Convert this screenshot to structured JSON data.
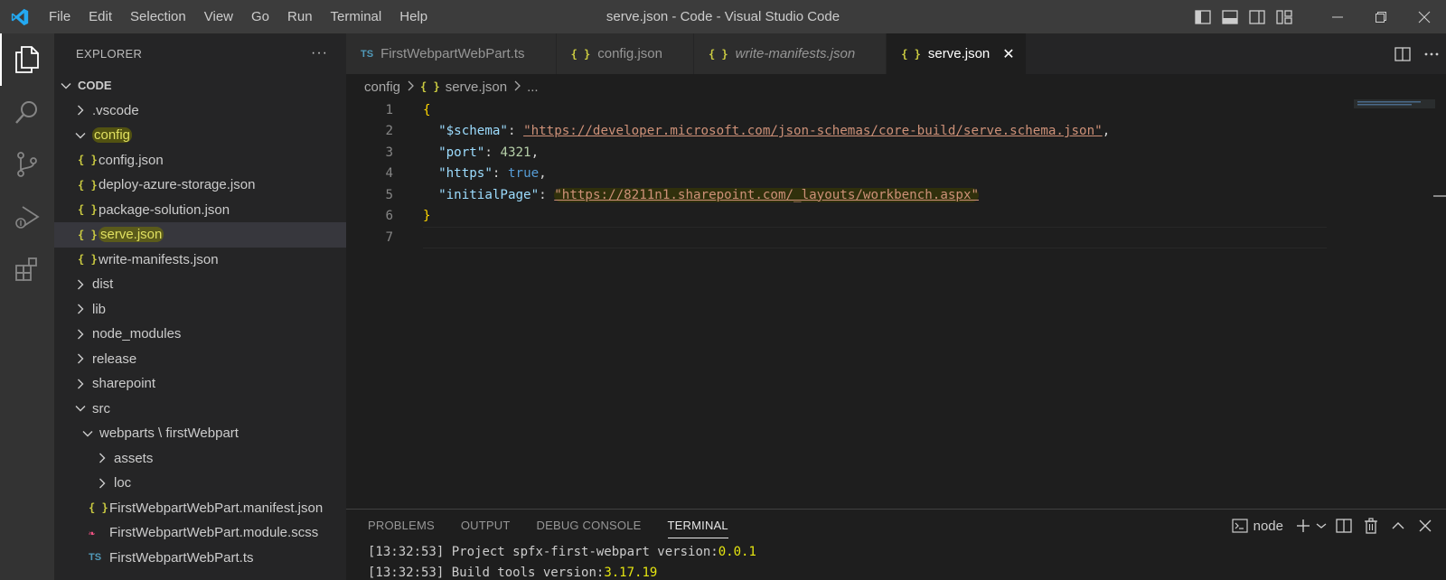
{
  "titlebar": {
    "menu": [
      "File",
      "Edit",
      "Selection",
      "View",
      "Go",
      "Run",
      "Terminal",
      "Help"
    ],
    "window_title": "serve.json - Code - Visual Studio Code"
  },
  "sidebar": {
    "title": "EXPLORER",
    "more": "···",
    "tree": [
      {
        "label": "CODE",
        "level": 0,
        "type": "folder-open",
        "bold": true
      },
      {
        "label": ".vscode",
        "level": 1,
        "type": "folder"
      },
      {
        "label": "config",
        "level": 1,
        "type": "folder-open",
        "highlight": true
      },
      {
        "label": "config.json",
        "level": 2,
        "type": "json"
      },
      {
        "label": "deploy-azure-storage.json",
        "level": 2,
        "type": "json"
      },
      {
        "label": "package-solution.json",
        "level": 2,
        "type": "json"
      },
      {
        "label": "serve.json",
        "level": 2,
        "type": "json",
        "selected": true,
        "highlight": true
      },
      {
        "label": "write-manifests.json",
        "level": 2,
        "type": "json"
      },
      {
        "label": "dist",
        "level": 1,
        "type": "folder"
      },
      {
        "label": "lib",
        "level": 1,
        "type": "folder"
      },
      {
        "label": "node_modules",
        "level": 1,
        "type": "folder"
      },
      {
        "label": "release",
        "level": 1,
        "type": "folder"
      },
      {
        "label": "sharepoint",
        "level": 1,
        "type": "folder"
      },
      {
        "label": "src",
        "level": 1,
        "type": "folder-open"
      },
      {
        "label": "webparts \\ firstWebpart",
        "level": 2,
        "type": "folder-open"
      },
      {
        "label": "assets",
        "level": 3,
        "type": "folder"
      },
      {
        "label": "loc",
        "level": 3,
        "type": "folder"
      },
      {
        "label": "FirstWebpartWebPart.manifest.json",
        "level": 3,
        "type": "json"
      },
      {
        "label": "FirstWebpartWebPart.module.scss",
        "level": 3,
        "type": "scss"
      },
      {
        "label": "FirstWebpartWebPart.ts",
        "level": 3,
        "type": "ts"
      }
    ]
  },
  "tabs": [
    {
      "label": "FirstWebpartWebPart.ts",
      "icon": "TS",
      "type": "ts"
    },
    {
      "label": "config.json",
      "icon": "{ }",
      "type": "json"
    },
    {
      "label": "write-manifests.json",
      "icon": "{ }",
      "type": "json",
      "italic": true
    },
    {
      "label": "serve.json",
      "icon": "{ }",
      "type": "json",
      "active": true,
      "close": "✕"
    }
  ],
  "breadcrumb": {
    "folder": "config",
    "file": "serve.json",
    "tail": "..."
  },
  "editor": {
    "line_numbers": [
      "1",
      "2",
      "3",
      "4",
      "5",
      "6",
      "7"
    ],
    "schema_key": "\"$schema\"",
    "schema_value": "\"https://developer.microsoft.com/json-schemas/core-build/serve.schema.json\"",
    "port_key": "\"port\"",
    "port_value": "4321",
    "https_key": "\"https\"",
    "https_value": "true",
    "initial_key": "\"initialPage\"",
    "initial_value": "\"https://8211n1.sharepoint.com/_layouts/workbench.aspx\""
  },
  "panel": {
    "tabs": [
      "PROBLEMS",
      "OUTPUT",
      "DEBUG CONSOLE",
      "TERMINAL"
    ],
    "active_tab": "TERMINAL",
    "terminal_name": "node",
    "lines": [
      {
        "time": "[13:32:53]",
        "text": " Project spfx-first-webpart version:",
        "value": "0.0.1"
      },
      {
        "time": "[13:32:53]",
        "text": " Build tools version:",
        "value": "3.17.19"
      }
    ]
  },
  "colors": {
    "accent_blue": "#23a9f2",
    "json_icon": "#cbcb41",
    "ts_icon": "#519aba",
    "scss_icon": "#f55385"
  }
}
